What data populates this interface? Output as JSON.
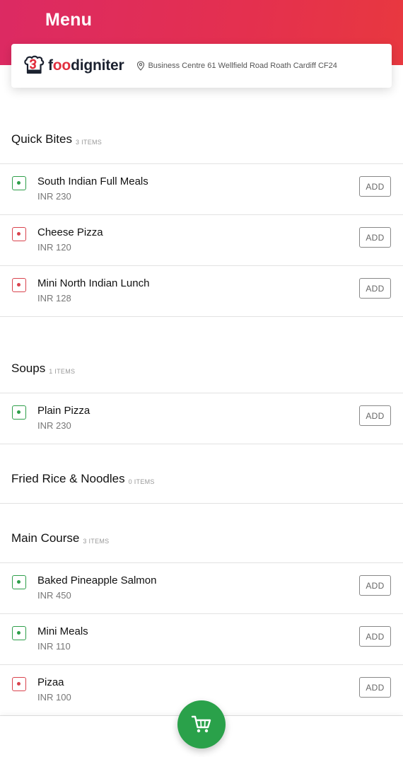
{
  "header": {
    "title": "Menu"
  },
  "brand": {
    "name_start": "f",
    "name_accent": "oo",
    "name_end": "digniter",
    "address": "Business Centre 61 Wellfield Road Roath Cardiff CF24"
  },
  "add_label": "ADD",
  "categories": [
    {
      "name": "Quick Bites",
      "count": "3 ITEMS",
      "items": [
        {
          "name": "South Indian Full Meals",
          "price": "INR 230",
          "type": "veg"
        },
        {
          "name": "Cheese Pizza",
          "price": "INR 120",
          "type": "non-veg"
        },
        {
          "name": "Mini North Indian Lunch",
          "price": "INR 128",
          "type": "non-veg"
        }
      ]
    },
    {
      "name": "Soups",
      "count": "1 ITEMS",
      "items": [
        {
          "name": "Plain Pizza",
          "price": "INR 230",
          "type": "veg"
        }
      ]
    },
    {
      "name": "Fried Rice & Noodles",
      "count": "0 ITEMS",
      "items": []
    },
    {
      "name": "Main Course",
      "count": "3 ITEMS",
      "items": [
        {
          "name": "Baked Pineapple Salmon",
          "price": "INR 450",
          "type": "veg"
        },
        {
          "name": "Mini Meals",
          "price": "INR 110",
          "type": "veg"
        },
        {
          "name": "Pizaa",
          "price": "INR 100",
          "type": "non-veg"
        }
      ]
    }
  ],
  "icons": {
    "cart": "cart-icon",
    "pin": "location-pin-icon",
    "logo": "chef-hat-logo-icon"
  },
  "colors": {
    "header": "#e2304f",
    "veg": "#2e9e4a",
    "non_veg": "#d9434d",
    "cart": "#2aa14a"
  }
}
